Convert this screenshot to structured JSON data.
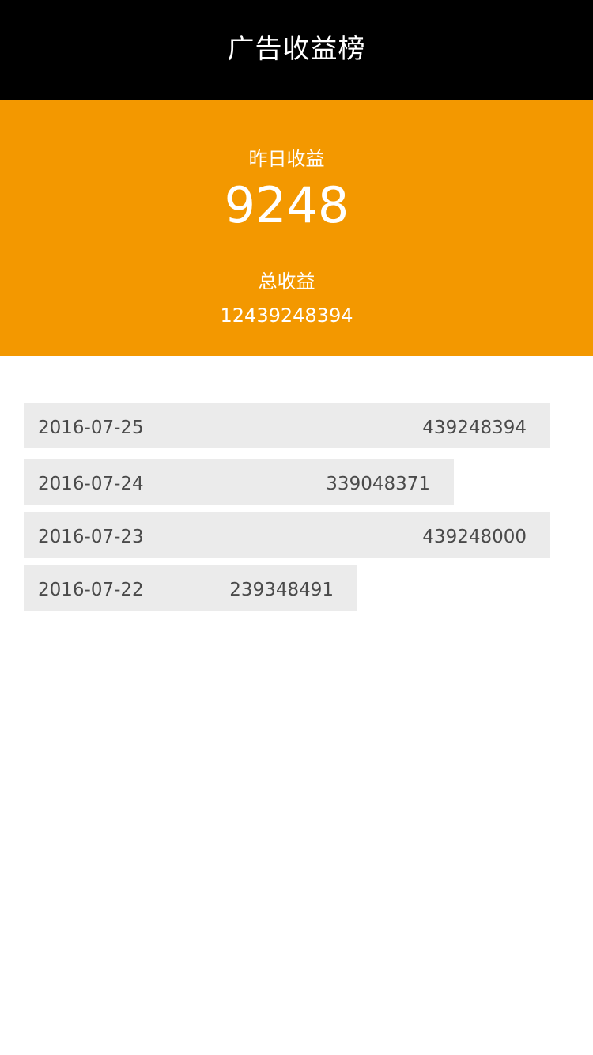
{
  "header": {
    "title": "广告收益榜"
  },
  "summary": {
    "yesterday_label": "昨日收益",
    "yesterday_value": "9248",
    "total_label": "总收益",
    "total_value": "12439248394"
  },
  "ranking": {
    "max_amount": 439248394,
    "rows": [
      {
        "date": "2016-07-25",
        "amount": "439248394",
        "amount_num": 439248394
      },
      {
        "date": "2016-07-24",
        "amount": "339048371",
        "amount_num": 339048371
      },
      {
        "date": "2016-07-23",
        "amount": "439248000",
        "amount_num": 439248000
      },
      {
        "date": "2016-07-22",
        "amount": "239348491",
        "amount_num": 239348491
      }
    ]
  },
  "colors": {
    "header_bg": "#000000",
    "accent": "#f39800",
    "bar_bg": "#ebebeb",
    "bar_text": "#4a4a4a"
  }
}
